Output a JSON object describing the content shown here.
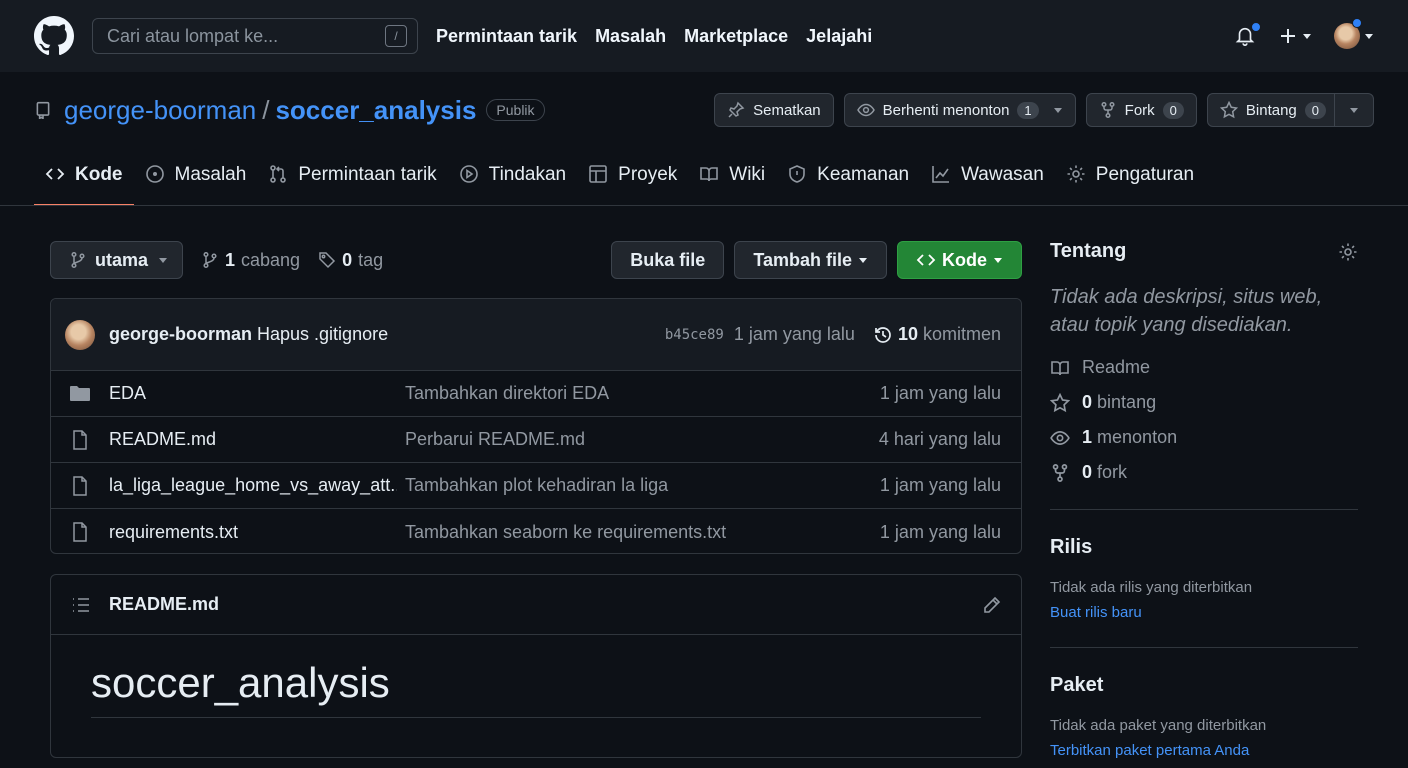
{
  "header": {
    "search_placeholder": "Cari atau lompat ke...",
    "slash_key": "/",
    "nav": [
      "Permintaan tarik",
      "Masalah",
      "Marketplace",
      "Jelajahi"
    ]
  },
  "repo": {
    "owner": "george-boorman",
    "separator": "/",
    "name": "soccer_analysis",
    "visibility": "Publik",
    "pin_label": "Sematkan",
    "watch_label": "Berhenti menonton",
    "watch_count": "1",
    "fork_label": "Fork",
    "fork_count": "0",
    "star_label": "Bintang",
    "star_count": "0"
  },
  "tabs": [
    "Kode",
    "Masalah",
    "Permintaan tarik",
    "Tindakan",
    "Proyek",
    "Wiki",
    "Keamanan",
    "Wawasan",
    "Pengaturan"
  ],
  "controls": {
    "branch": "utama",
    "branch_count": "1",
    "branch_label": "cabang",
    "tag_count": "0",
    "tag_label": "tag",
    "go_to_file": "Buka file",
    "add_file": "Tambah file",
    "code": "Kode"
  },
  "commit": {
    "user": "george-boorman",
    "message": "Hapus .gitignore",
    "sha": "b45ce89",
    "time": "1 jam yang lalu",
    "count": "10",
    "count_label": "komitmen"
  },
  "files": [
    {
      "name": "EDA",
      "type": "folder",
      "message": "Tambahkan direktori EDA",
      "time": "1 jam yang lalu"
    },
    {
      "name": "README.md",
      "type": "file",
      "message": "Perbarui README.md",
      "time": "4 hari yang lalu"
    },
    {
      "name": "la_liga_league_home_vs_away_att...",
      "type": "file",
      "message": "Tambahkan plot kehadiran la liga",
      "time": "1 jam yang lalu"
    },
    {
      "name": "requirements.txt",
      "type": "file",
      "message": "Tambahkan seaborn ke requirements.txt",
      "time": "1 jam yang lalu"
    }
  ],
  "readme": {
    "file_label": "README.md",
    "title": "soccer_analysis"
  },
  "sidebar": {
    "about_title": "Tentang",
    "description": "Tidak ada deskripsi, situs web, atau topik yang disediakan.",
    "readme": "Readme",
    "stars_count": "0",
    "stars_label": "bintang",
    "watching_count": "1",
    "watching_label": "menonton",
    "forks_count": "0",
    "forks_label": "fork",
    "releases_title": "Rilis",
    "no_releases": "Tidak ada rilis yang diterbitkan",
    "create_release": "Buat rilis baru",
    "packages_title": "Paket",
    "no_packages": "Tidak ada paket yang diterbitkan",
    "publish_package": "Terbitkan paket pertama Anda"
  },
  "colors": {
    "background": "#0d1117",
    "header": "#161b22",
    "link": "#4493f8",
    "green_button": "#238636",
    "active_tab": "#f78166",
    "notification_dot": "#2f81f7"
  }
}
